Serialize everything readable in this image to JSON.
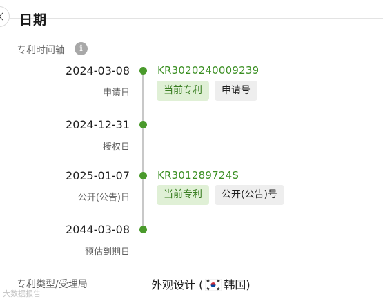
{
  "section": {
    "title": "日期"
  },
  "timeline": {
    "label": "专利时间轴",
    "info_icon": "i",
    "events": [
      {
        "date": "2024-03-08",
        "kind": "申请日",
        "number": "KR3020240009239",
        "tags": [
          "当前专利",
          "申请号"
        ]
      },
      {
        "date": "2024-12-31",
        "kind": "授权日"
      },
      {
        "date": "2025-01-07",
        "kind": "公开(公告)日",
        "number": "KR301289724S",
        "tags": [
          "当前专利",
          "公开(公告)号"
        ]
      },
      {
        "date": "2044-03-08",
        "kind": "预估到期日"
      }
    ]
  },
  "meta": {
    "type_label": "专利类型/受理局",
    "type_value_prefix": "外观设计 (",
    "country": "韩国",
    "type_value_suffix": ")"
  },
  "watermark": "大数据报告",
  "colors": {
    "accent_green": "#4a9a2c",
    "tag_current_bg": "#e0f0d6",
    "tag_neutral_bg": "#eeeeee"
  },
  "icons": {
    "back": "chevron-left-icon",
    "info": "info-icon",
    "flag": "south-korea-flag-icon"
  }
}
